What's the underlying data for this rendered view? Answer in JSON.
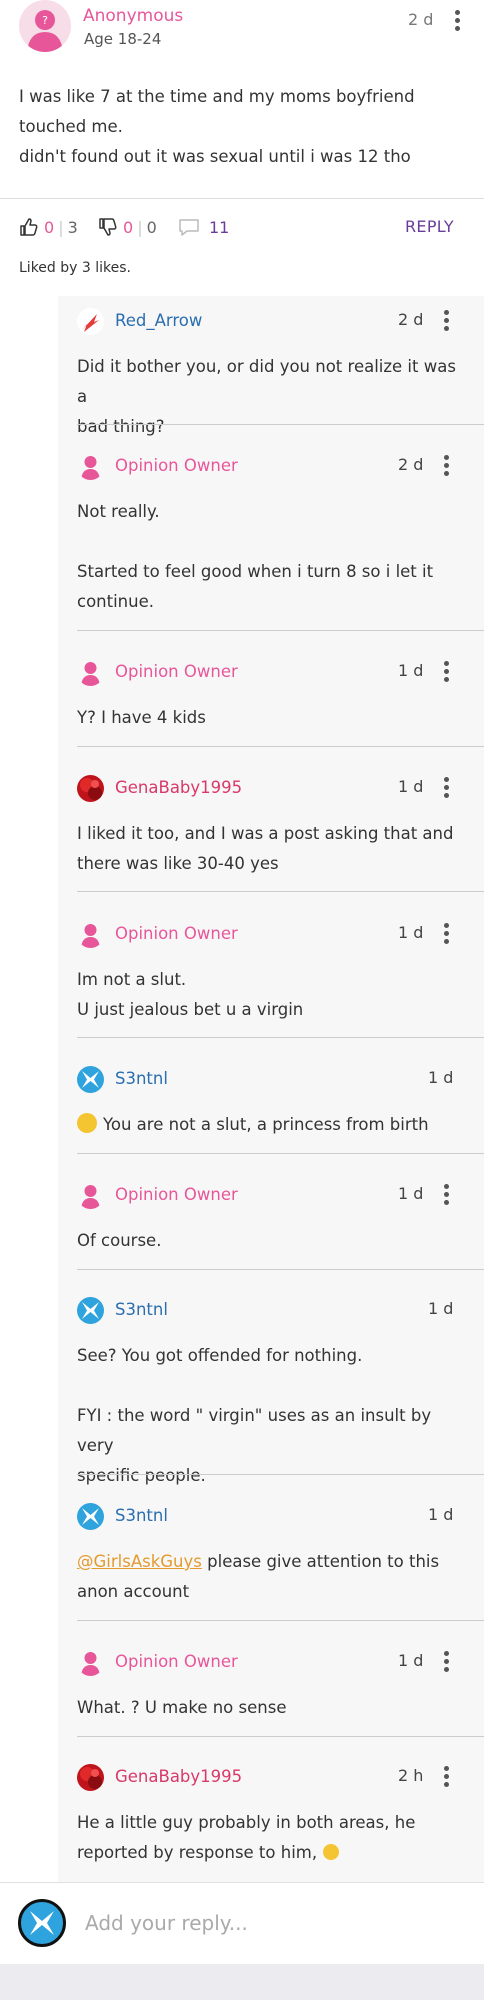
{
  "opinion": {
    "author": "Anonymous",
    "age": "Age 18-24",
    "time": "2 d",
    "body": [
      "I was like 7 at the time and my moms boyfriend touched me.",
      "didn't found out it was sexual until i was 12 tho"
    ],
    "likes": "0",
    "likes_total": "3",
    "dislikes": "0",
    "dislikes_total": "0",
    "comments_count": "11",
    "reply_label": "REPLY",
    "liked_by": "Liked by 3 likes."
  },
  "comments": [
    {
      "author": "Red_Arrow",
      "time": "2 d",
      "lines": [
        "Did it bother you, or did you not realize it was a",
        "bad thing?"
      ]
    },
    {
      "author": "Opinion Owner",
      "time": "2 d",
      "lines": [
        "Not really.",
        "",
        "Started to feel good when i turn 8 so i let it",
        "continue."
      ]
    },
    {
      "author": "Opinion Owner",
      "time": "1 d",
      "lines": [
        "Y? I have 4 kids"
      ]
    },
    {
      "author": "GenaBaby1995",
      "time": "1 d",
      "lines": [
        "I liked it too, and I was a post asking that and",
        "there was like 30-40 yes"
      ]
    },
    {
      "author": "Opinion Owner",
      "time": "1 d",
      "lines": [
        "Im not a slut.",
        "U just jealous bet u a virgin"
      ]
    },
    {
      "author": "S3ntnl",
      "time": "1 d",
      "lines": [
        "You are not a slut, a princess from birth"
      ]
    },
    {
      "author": "Opinion Owner",
      "time": "1 d",
      "lines": [
        "Of course."
      ]
    },
    {
      "author": "S3ntnl",
      "time": "1 d",
      "lines": [
        "See? You got offended for nothing.",
        "",
        "FYI : the word \" virgin\" uses as an insult by very",
        "specific people."
      ]
    },
    {
      "author": "S3ntnl",
      "time": "1 d",
      "mention": "@GirlsAskGuys",
      "lines": [
        " please give attention to this",
        "anon account"
      ]
    },
    {
      "author": "Opinion Owner",
      "time": "1 d",
      "lines": [
        "What. ? U make no sense"
      ]
    },
    {
      "author": "GenaBaby1995",
      "time": "2 h",
      "lines": [
        "He a little guy probably in both areas, he",
        "reported by response to him,"
      ]
    }
  ],
  "reply_bar": {
    "placeholder": "Add your reply..."
  },
  "colors": {
    "accent_pink": "#e8569a",
    "link_blue": "#2b6eb0",
    "reply_purple": "#6a3d9a",
    "mention_orange": "#e39b2e"
  }
}
